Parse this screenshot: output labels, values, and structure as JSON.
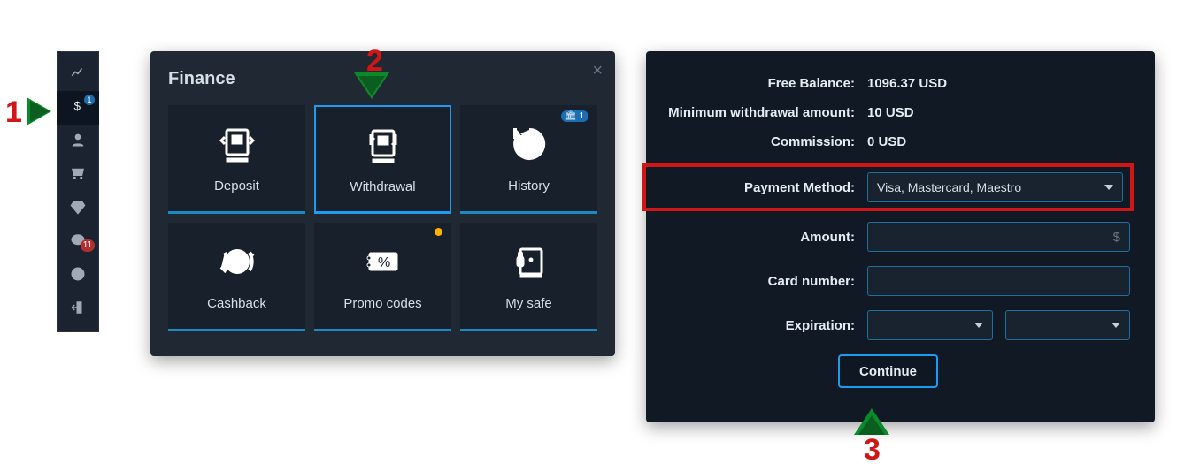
{
  "sidebar": {
    "items": [
      {
        "icon": "chart-icon"
      },
      {
        "icon": "dollar-icon",
        "badge": "1",
        "active": true
      },
      {
        "icon": "user-icon"
      },
      {
        "icon": "cart-icon"
      },
      {
        "icon": "diamond-icon"
      },
      {
        "icon": "chat-icon",
        "badge": "11",
        "badge_color": "red"
      },
      {
        "icon": "help-icon"
      },
      {
        "icon": "logout-icon"
      }
    ]
  },
  "finance": {
    "title": "Finance",
    "tiles": [
      {
        "key": "deposit",
        "label": "Deposit"
      },
      {
        "key": "withdrawal",
        "label": "Withdrawal",
        "selected": true
      },
      {
        "key": "history",
        "label": "History",
        "badge_icon": "bank",
        "badge_text": "1"
      },
      {
        "key": "cashback",
        "label": "Cashback"
      },
      {
        "key": "promocodes",
        "label": "Promo codes",
        "dot": true
      },
      {
        "key": "mysafe",
        "label": "My safe"
      }
    ]
  },
  "form": {
    "rows": [
      {
        "label": "Free Balance:",
        "value": "1096.37 USD"
      },
      {
        "label": "Minimum withdrawal amount:",
        "value": "10 USD"
      },
      {
        "label": "Commission:",
        "value": "0 USD"
      }
    ],
    "payment_method": {
      "label": "Payment Method:",
      "selected": "Visa, Mastercard, Maestro"
    },
    "amount": {
      "label": "Amount:",
      "value": "",
      "suffix": "$"
    },
    "card": {
      "label": "Card number:",
      "value": ""
    },
    "expiration": {
      "label": "Expiration:",
      "month": "",
      "year": ""
    },
    "continue_label": "Continue"
  },
  "markers": {
    "one": "1",
    "two": "2",
    "three": "3"
  }
}
